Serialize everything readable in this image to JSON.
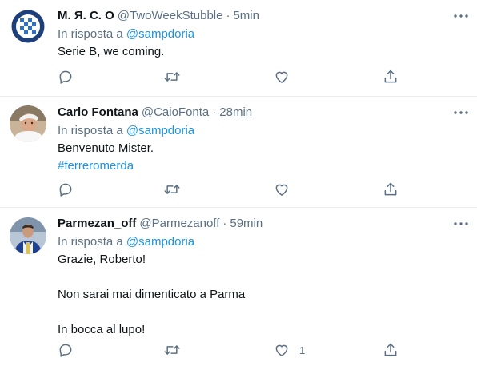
{
  "tweets": [
    {
      "name": "М. Я. С. О",
      "handle": "@TwoWeekStubble",
      "separator": "·",
      "time": "5min",
      "reply_prefix": "In risposta a",
      "reply_to": "@sampdoria",
      "lines": [
        "Serie B, we coming."
      ],
      "like_count": ""
    },
    {
      "name": "Carlo Fontana",
      "handle": "@CaioFonta",
      "separator": "·",
      "time": "28min",
      "reply_prefix": "In risposta a",
      "reply_to": "@sampdoria",
      "lines": [
        "Benvenuto Mister."
      ],
      "hashtag": "#ferreromerda",
      "like_count": ""
    },
    {
      "name": "Parmezan_off",
      "handle": "@Parmezanoff",
      "separator": "·",
      "time": "59min",
      "reply_prefix": "In risposta a",
      "reply_to": "@sampdoria",
      "lines": [
        "Grazie, Roberto!",
        "",
        "Non sarai mai dimenticato a Parma",
        "",
        "In bocca al lupo!"
      ],
      "like_count": "1"
    }
  ],
  "colors": {
    "text": "#0f1419",
    "secondary": "#5b7083",
    "link": "#1b95e0",
    "border": "#ebeef0"
  },
  "icons": {
    "reply": "reply-icon",
    "retweet": "retweet-icon",
    "like": "heart-icon",
    "share": "share-icon",
    "more": "more-icon"
  }
}
